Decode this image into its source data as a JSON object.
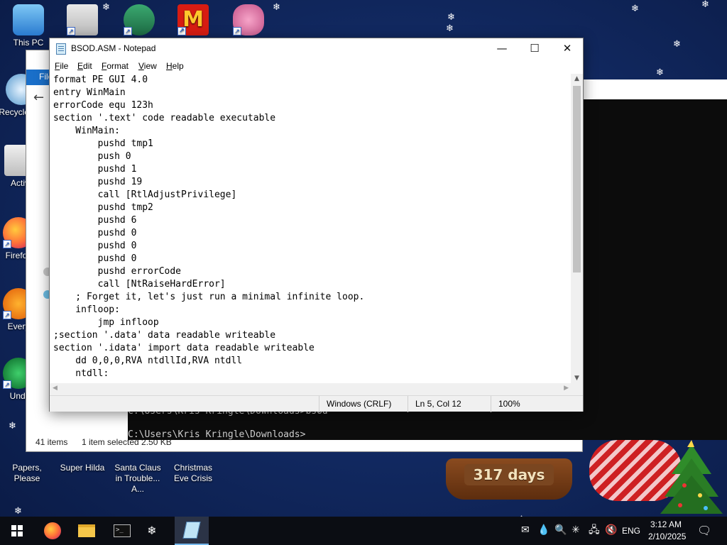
{
  "desktop": {
    "icons": [
      {
        "label": "This PC"
      },
      {
        "label": "Recycle Bin"
      },
      {
        "label": "Activ"
      },
      {
        "label": "Firefox"
      },
      {
        "label": "Every"
      },
      {
        "label": "Undi"
      },
      {
        "label": "Papers, Please"
      },
      {
        "label": "Super Hilda"
      },
      {
        "label": "Santa Claus in Trouble... A..."
      },
      {
        "label": "Christmas Eve Crisis"
      }
    ],
    "top_icons": [
      "media-icon",
      "game-icon",
      "mcdonalds-icon",
      "piggy-icon"
    ]
  },
  "explorer": {
    "ribbon_label": "File",
    "status_items": "41 items",
    "status_selected": "1 item selected  2.50 KB"
  },
  "cmd": {
    "lines": [
      "C:\\Users\\Kris Kringle\\Downloads>bsod",
      "C:\\Users\\Kris Kringle\\Downloads>"
    ]
  },
  "notepad": {
    "title": "BSOD.ASM - Notepad",
    "controls": {
      "minimize": "—",
      "maximize": "☐",
      "close": "✕"
    },
    "menu": [
      {
        "key": "F",
        "rest": "ile"
      },
      {
        "key": "E",
        "rest": "dit"
      },
      {
        "key": "F",
        "rest": "ormat"
      },
      {
        "key": "V",
        "rest": "iew"
      },
      {
        "key": "H",
        "rest": "elp"
      }
    ],
    "lines": [
      "format PE GUI 4.0",
      "entry WinMain",
      "errorCode equ 123h",
      "section '.text' code readable executable",
      "    WinMain:",
      "        pushd tmp1",
      "        push 0",
      "        pushd 1",
      "        pushd 19",
      "        call [RtlAdjustPrivilege]",
      "        pushd tmp2",
      "        pushd 6",
      "        pushd 0",
      "        pushd 0",
      "        pushd 0",
      "        pushd errorCode",
      "        call [NtRaiseHardError]",
      "    ; Forget it, let's just run a minimal infinite loop.",
      "    infloop:",
      "        jmp infloop",
      ";section '.data' data readable writeable",
      "section '.idata' import data readable writeable",
      "    dd 0,0,0,RVA ntdllId,RVA ntdll",
      "    ntdll:"
    ],
    "status": {
      "line_ending": "Windows (CRLF)",
      "position": "Ln 5, Col 12",
      "zoom": "100%"
    }
  },
  "countdown": "317 days",
  "taskbar": {
    "pinned": [
      "start-icon",
      "firefox-icon",
      "file-explorer-icon",
      "command-prompt-icon",
      "snow-app-icon",
      "notepad-icon"
    ],
    "language": "ENG",
    "time": "3:12 AM",
    "date": "2/10/2025"
  }
}
